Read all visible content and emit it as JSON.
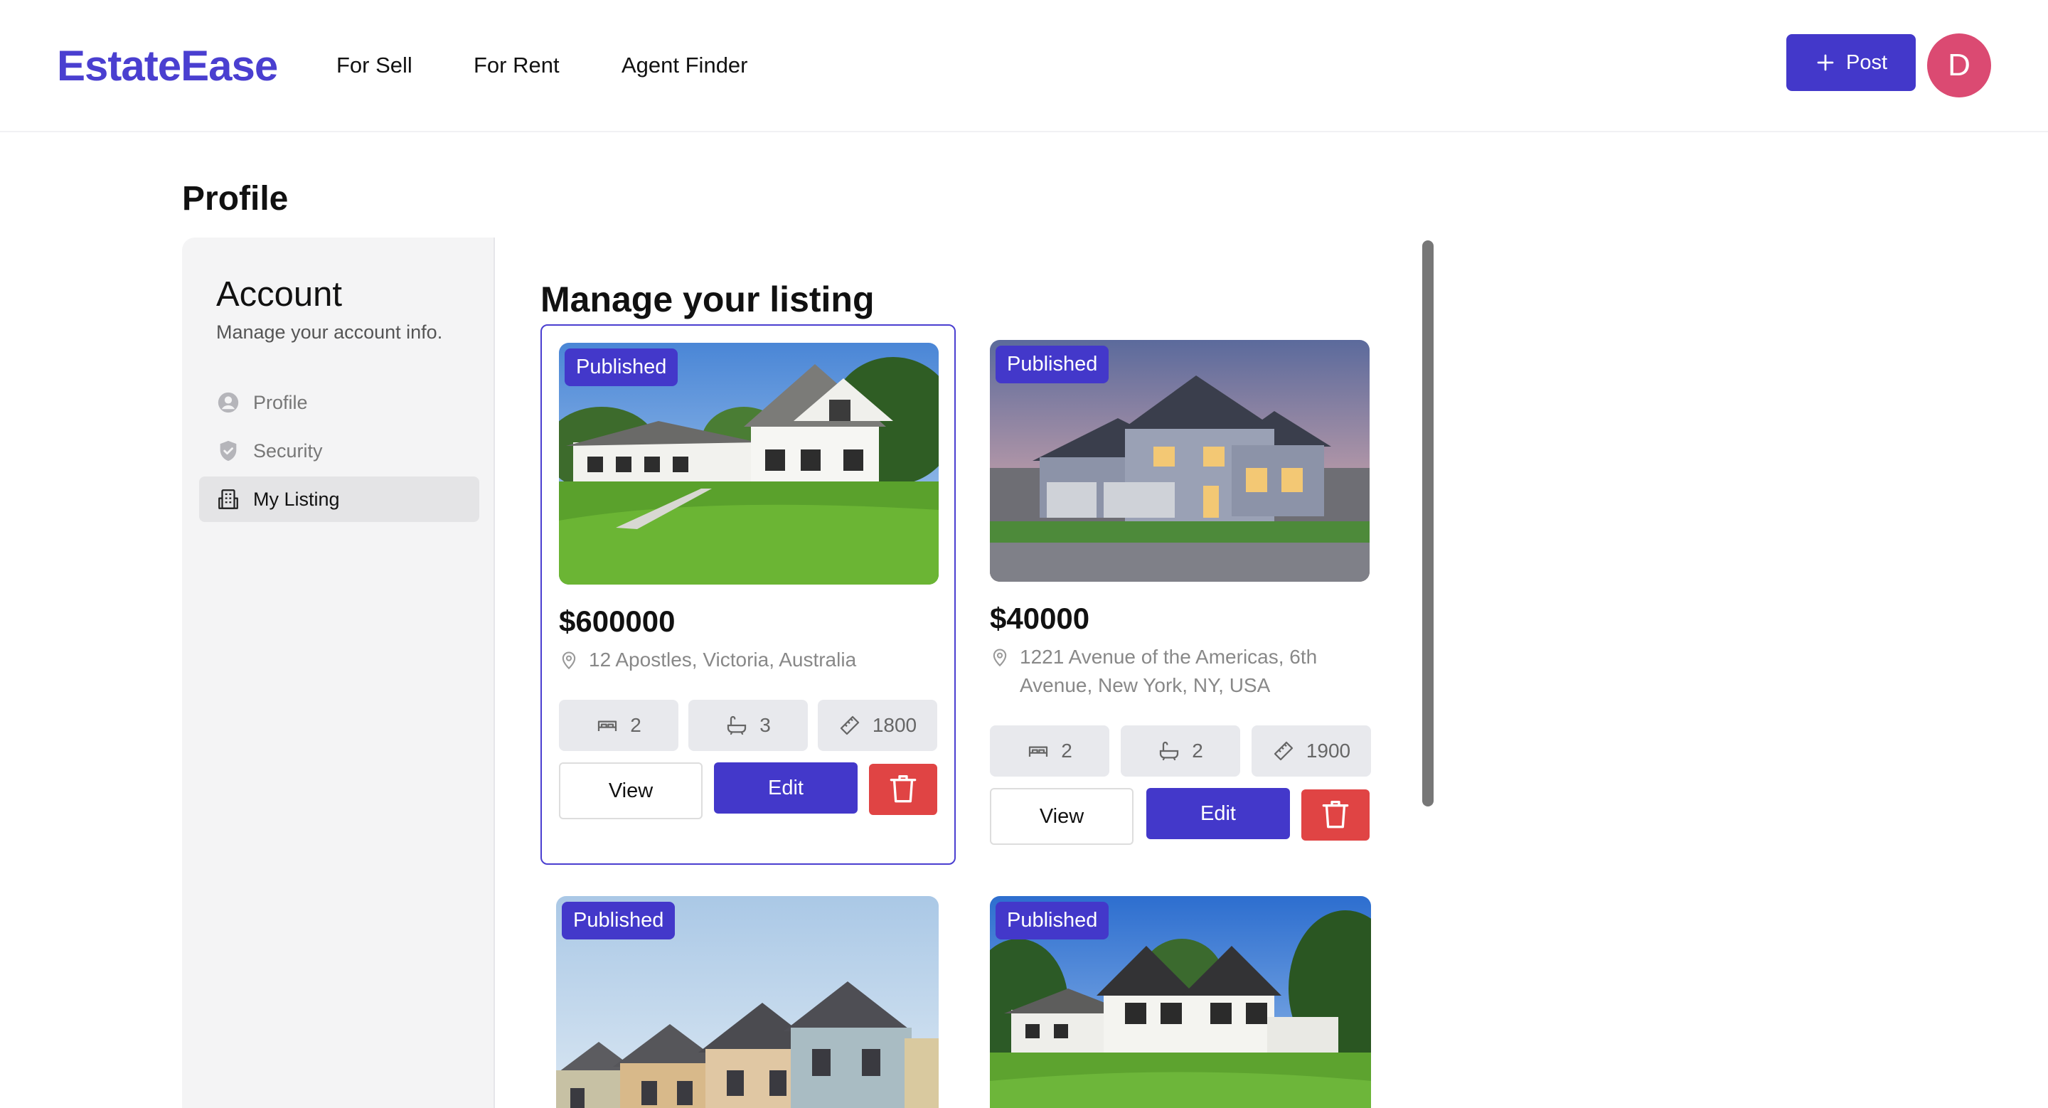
{
  "brand": {
    "name": "EstateEase",
    "color": "#4a3fd0"
  },
  "nav": {
    "links": [
      "For Sell",
      "For Rent",
      "Agent Finder"
    ],
    "post_label": "Post",
    "avatar_initial": "D"
  },
  "page": {
    "title": "Profile"
  },
  "sidebar": {
    "title": "Account",
    "subtitle": "Manage your account info.",
    "items": [
      {
        "label": "Profile",
        "icon": "user-circle-icon",
        "active": false
      },
      {
        "label": "Security",
        "icon": "shield-check-icon",
        "active": false
      },
      {
        "label": "My Listing",
        "icon": "building-icon",
        "active": true
      }
    ]
  },
  "main": {
    "heading": "Manage your listing",
    "actions": {
      "view": "View",
      "edit": "Edit"
    },
    "listings": [
      {
        "status": "Published",
        "price": "$600000",
        "address": "12 Apostles, Victoria, Australia",
        "beds": "2",
        "baths": "3",
        "area": "1800"
      },
      {
        "status": "Published",
        "price": "$40000",
        "address": "1221 Avenue of the Americas, 6th Avenue, New York, NY, USA",
        "beds": "2",
        "baths": "2",
        "area": "1900"
      },
      {
        "status": "Published"
      },
      {
        "status": "Published"
      }
    ]
  },
  "colors": {
    "accent": "#4338ca",
    "danger": "#e04444",
    "avatar": "#db4a72",
    "stat_bg": "#e8e9ed"
  }
}
